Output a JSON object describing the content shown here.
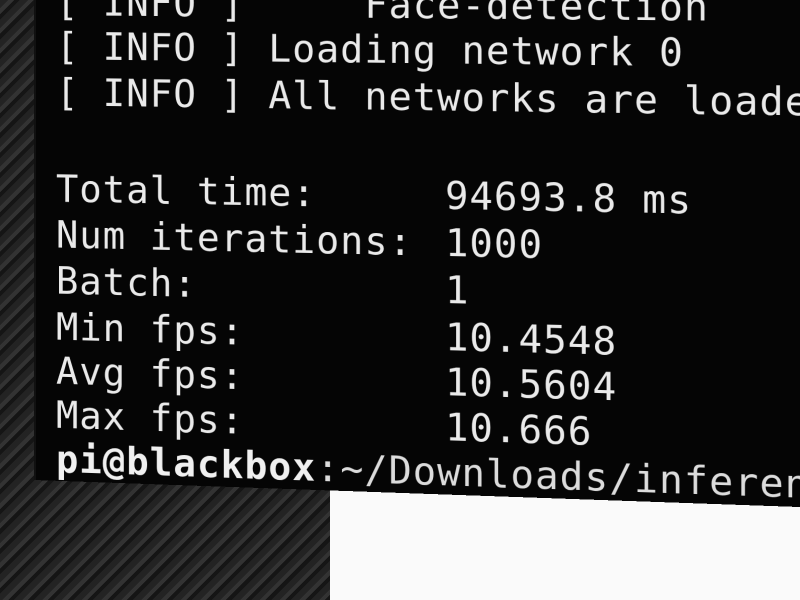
{
  "terminal": {
    "log_lines": [
      "[ INFO ]     Face-detection",
      "[ INFO ] Loading network 0",
      "[ INFO ] All networks are loade"
    ],
    "stats": [
      {
        "label": "Total time:",
        "value": "94693.8 ms"
      },
      {
        "label": "Num iterations:",
        "value": "1000"
      },
      {
        "label": "Batch:",
        "value": "1"
      },
      {
        "label": "Min fps:",
        "value": "10.4548"
      },
      {
        "label": "Avg fps:",
        "value": "10.5604"
      },
      {
        "label": "Max fps:",
        "value": "10.666"
      }
    ],
    "prompt_user_host": "pi@blackbox",
    "prompt_path": ":~/Downloads/inferenc"
  }
}
